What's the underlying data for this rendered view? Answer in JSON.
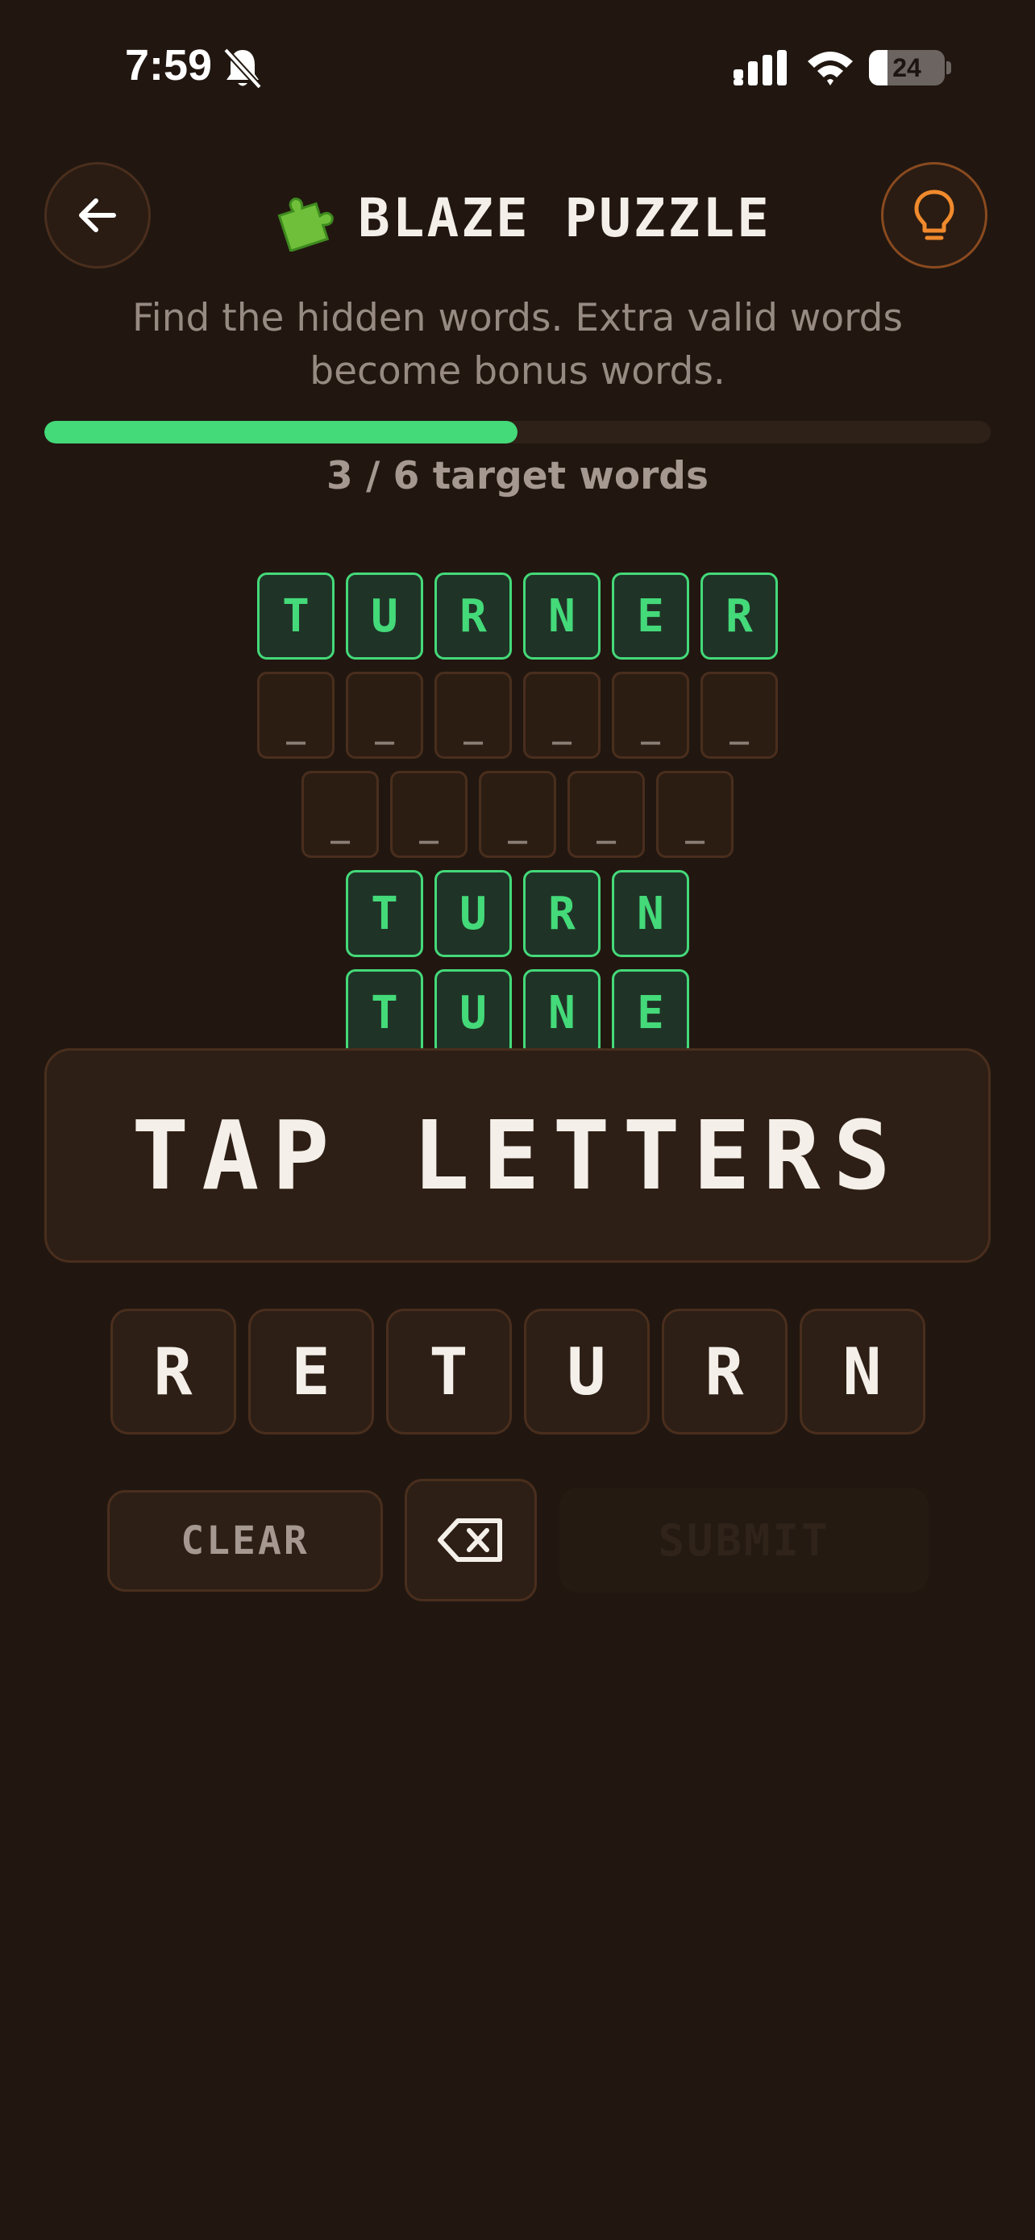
{
  "status_bar": {
    "time": "7:59",
    "battery_level": "24",
    "battery_fraction": 0.24
  },
  "header": {
    "title": "BLAZE PUZZLE",
    "title_icon": "puzzle-piece-icon",
    "back_icon": "arrow-left-icon",
    "hint_icon": "lightbulb-icon"
  },
  "subtitle": "Find the hidden words. Extra valid words become bonus words.",
  "progress": {
    "found": 3,
    "total": 6,
    "fraction": 0.5,
    "label": "3 / 6 target words"
  },
  "word_grid": {
    "rows": [
      {
        "found": true,
        "letters": [
          "T",
          "U",
          "R",
          "N",
          "E",
          "R"
        ]
      },
      {
        "found": false,
        "letters": [
          "_",
          "_",
          "_",
          "_",
          "_",
          "_"
        ]
      },
      {
        "found": false,
        "letters": [
          "_",
          "_",
          "_",
          "_",
          "_"
        ]
      },
      {
        "found": true,
        "letters": [
          "T",
          "U",
          "R",
          "N"
        ]
      },
      {
        "found": true,
        "letters": [
          "T",
          "U",
          "N",
          "E"
        ]
      }
    ]
  },
  "input": {
    "placeholder": "TAP LETTERS"
  },
  "letters": [
    "R",
    "E",
    "T",
    "U",
    "R",
    "N"
  ],
  "actions": {
    "clear_label": "CLEAR",
    "submit_label": "SUBMIT",
    "backspace_icon": "backspace-icon"
  },
  "colors": {
    "background": "#211710",
    "accent_green": "#44d979",
    "hint_orange": "#f08a2c",
    "panel": "#2d1f15",
    "border": "#4a2e1d"
  }
}
